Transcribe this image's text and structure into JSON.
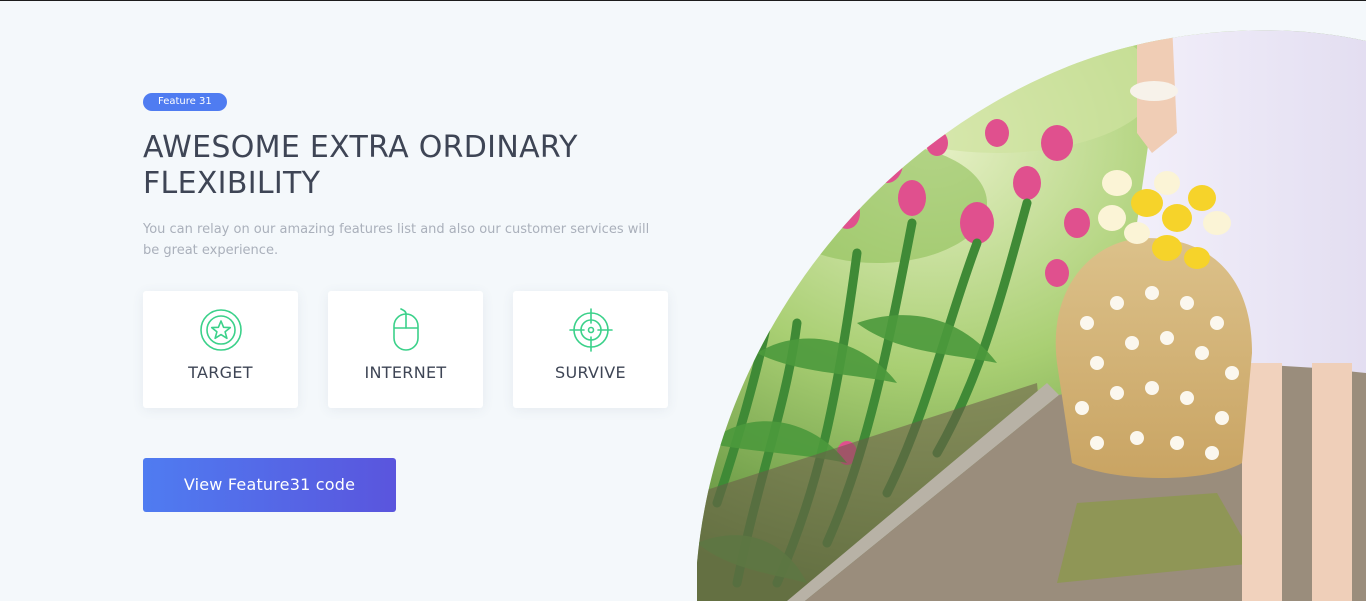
{
  "badge": "Feature 31",
  "title": "AWESOME EXTRA ORDINARY FLEXIBILITY",
  "description": "You can relay on our amazing features list and also our customer services will be great experience.",
  "features": [
    {
      "label": "TARGET",
      "icon": "star-badge-icon"
    },
    {
      "label": "INTERNET",
      "icon": "mouse-icon"
    },
    {
      "label": "SURVIVE",
      "icon": "crosshair-icon"
    }
  ],
  "cta": {
    "label": "View Feature31 code"
  },
  "colors": {
    "accent": "#4f7cf1",
    "accent_end": "#5a55dd",
    "icon_green": "#3bd18a",
    "heading": "#3e4555",
    "muted": "#aab0bb",
    "background": "#f4f8fb"
  }
}
